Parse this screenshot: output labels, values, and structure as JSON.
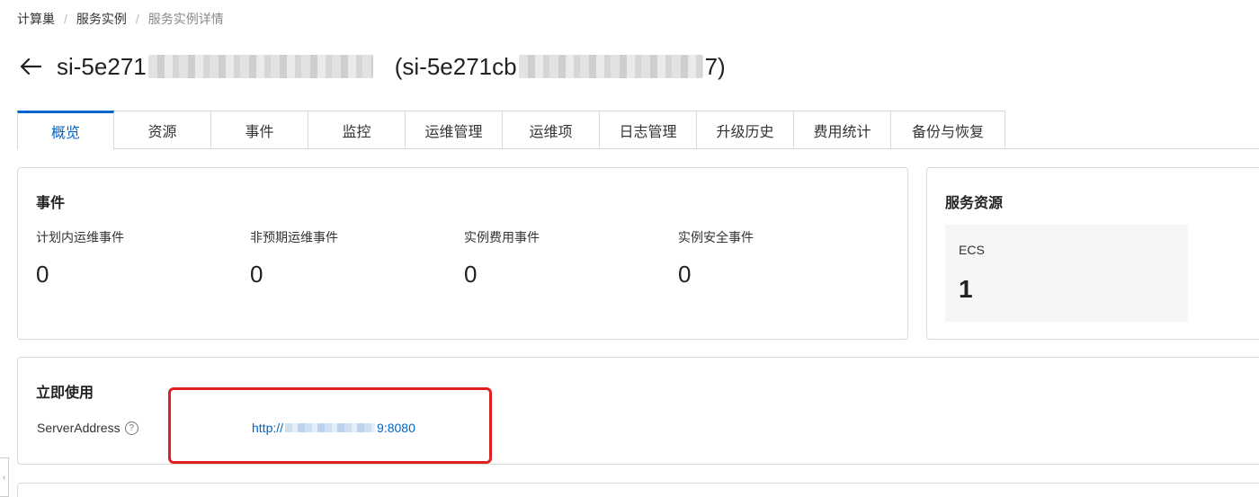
{
  "breadcrumb": {
    "items": [
      "计算巢",
      "服务实例"
    ],
    "current": "服务实例详情",
    "separator": "/"
  },
  "title": {
    "prefix": "si-5e271",
    "paren_prefix": "(si-5e271cb",
    "paren_suffix": "7)"
  },
  "tabs": [
    "概览",
    "资源",
    "事件",
    "监控",
    "运维管理",
    "运维项",
    "日志管理",
    "升级历史",
    "费用统计",
    "备份与恢复"
  ],
  "events": {
    "title": "事件",
    "metrics": [
      {
        "label": "计划内运维事件",
        "value": "0"
      },
      {
        "label": "非预期运维事件",
        "value": "0"
      },
      {
        "label": "实例费用事件",
        "value": "0"
      },
      {
        "label": "实例安全事件",
        "value": "0"
      }
    ]
  },
  "service_resources": {
    "title": "服务资源",
    "type": "ECS",
    "count": "1"
  },
  "use_now": {
    "title": "立即使用",
    "label": "ServerAddress",
    "link_prefix": "http://",
    "link_suffix": "9:8080"
  },
  "colors": {
    "accent": "#0064c8",
    "highlight": "#e02020"
  },
  "icons": {
    "back": "arrow-left-icon",
    "help": "question-circle-icon",
    "collapse": "chevron-left-icon"
  }
}
